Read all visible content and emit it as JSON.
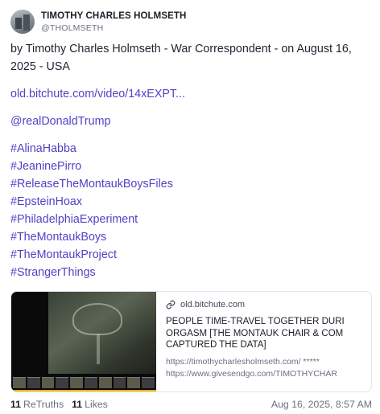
{
  "post": {
    "author": {
      "display_name": "TIMOTHY CHARLES HOLMSETH",
      "handle": "@THOLMSETH"
    },
    "intro": "by Timothy Charles Holmseth - War Correspondent - on August 16, 2025 - USA",
    "video_link": "old.bitchute.com/video/14xEXPT...",
    "mention": "@realDonaldTrump",
    "hashtags": [
      "#AlinaHabba",
      "#JeaninePirro",
      "#ReleaseTheMontaukBoysFiles",
      "#EpsteinHoax",
      "#PhiladelphiaExperiment",
      "#TheMontaukBoys",
      "#TheMontaukProject",
      "#StrangerThings"
    ],
    "card": {
      "domain": "old.bitchute.com",
      "title_lines": [
        "PEOPLE TIME-TRAVEL TOGETHER DURI",
        "ORGASM [THE MONTAUK CHAIR & COM",
        "CAPTURED THE DATA]"
      ],
      "desc_lines": [
        "https://timothycharlesholmseth.com/ *****",
        "https://www.givesendgo.com/TIMOTHYCHAR"
      ]
    },
    "stats": {
      "retruths_count": "11",
      "retruths_label": "ReTruths",
      "likes_count": "11",
      "likes_label": "Likes"
    },
    "timestamp": "Aug 16, 2025, 8:57 AM"
  },
  "colors": {
    "link": "#4f43c6",
    "text": "#222432",
    "muted": "#6b6e82",
    "progress": "#e7b416"
  },
  "icons": {
    "card_domain": "link-icon",
    "avatar": "profile-photo"
  }
}
